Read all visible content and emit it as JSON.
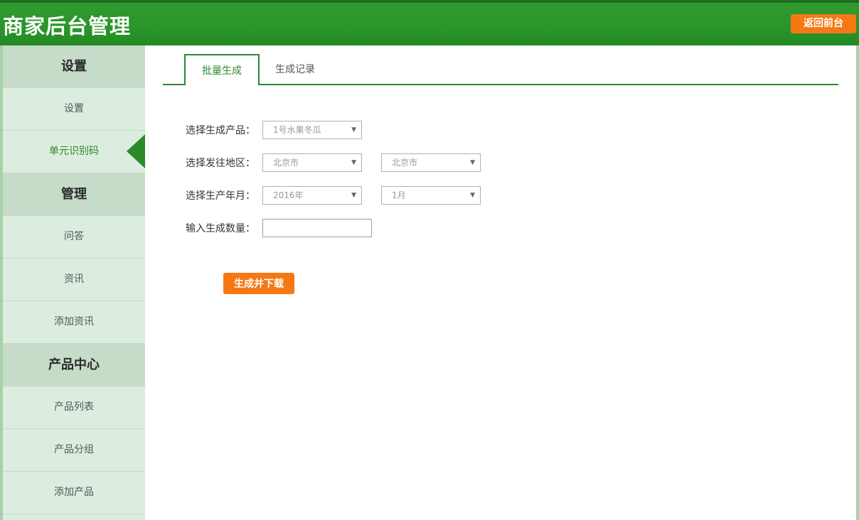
{
  "header": {
    "title": "商家后台管理",
    "back_button": "返回前台"
  },
  "sidebar": {
    "groups": [
      {
        "title": "设置",
        "items": [
          "设置",
          "单元识别码"
        ]
      },
      {
        "title": "管理",
        "items": [
          "问答",
          "资讯",
          "添加资讯"
        ]
      },
      {
        "title": "产品中心",
        "items": [
          "产品列表",
          "产品分组",
          "添加产品"
        ]
      }
    ],
    "active_item": "单元识别码"
  },
  "tabs": [
    "批量生成",
    "生成记录"
  ],
  "form": {
    "product_label": "选择生成产品：",
    "product_value": "1号水果冬瓜",
    "region_label": "选择发往地区：",
    "region_province": "北京市",
    "region_city": "北京市",
    "date_label": "选择生产年月：",
    "year_value": "2016年",
    "month_value": "1月",
    "quantity_label": "输入生成数量：",
    "quantity_value": "",
    "submit_button": "生成并下载"
  },
  "colors": {
    "brand_green": "#2b8a2b",
    "accent_orange": "#f57814",
    "sidebar_bg": "#dcede0",
    "sidebar_head_bg": "#c6dbc8"
  }
}
